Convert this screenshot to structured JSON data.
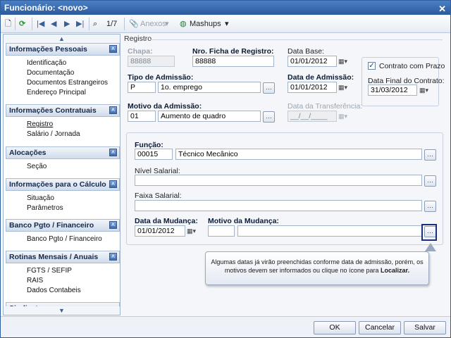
{
  "window": {
    "title": "Funcionário: <novo>"
  },
  "toolbar": {
    "record_counter": "1/7",
    "anexos_label": "Anexos",
    "mashups_label": "Mashups"
  },
  "sidebar": {
    "sections": [
      {
        "title": "Informações Pessoais",
        "items": [
          "Identificação",
          "Documentação",
          "Documentos Estrangeiros",
          "Endereço Principal"
        ]
      },
      {
        "title": "Informações Contratuais",
        "items": [
          "Registro",
          "Salário / Jornada"
        ]
      },
      {
        "title": "Alocações",
        "items": [
          "Seção"
        ]
      },
      {
        "title": "Informações para o Cálculo",
        "items": [
          "Situação",
          "Parâmetros"
        ]
      },
      {
        "title": "Banco Pgto / Financeiro",
        "items": [
          "Banco Pgto / Financeiro"
        ]
      },
      {
        "title": "Rotinas Mensais / Anuais",
        "items": [
          "FGTS / SEFIP",
          "RAIS",
          "Dados Contabeis"
        ]
      },
      {
        "title": "Sindicato",
        "items": []
      }
    ]
  },
  "form": {
    "section_title": "Registro",
    "chapa_label": "Chapa:",
    "chapa_value": "88888",
    "ficha_label": "Nro. Ficha de Registro:",
    "ficha_value": "88888",
    "data_base_label": "Data Base:",
    "data_base_value": "01/01/2012",
    "contrato_prazo_label": "Contrato com Prazo",
    "data_final_label": "Data Final do Contrato:",
    "data_final_value": "31/03/2012",
    "tipo_admissao_label": "Tipo de Admissão:",
    "tipo_admissao_code": "P",
    "tipo_admissao_desc": "1o. emprego",
    "data_admissao_label": "Data de Admissão:",
    "data_admissao_value": "01/01/2012",
    "motivo_admissao_label": "Motivo da Admissão:",
    "motivo_admissao_code": "01",
    "motivo_admissao_desc": "Aumento de quadro",
    "data_transferencia_label": "Data da Transferência:",
    "data_transferencia_value": "__/__/____",
    "funcao_label": "Função:",
    "funcao_code": "00015",
    "funcao_desc": "Técnico Mecânico",
    "nivel_salarial_label": "Nível Salarial:",
    "faixa_salarial_label": "Faixa Salarial:",
    "data_mudanca_label": "Data da Mudança:",
    "data_mudanca_value": "01/01/2012",
    "motivo_mudanca_label": "Motivo da Mudança:",
    "tooltip_text": "Algumas datas já virão preenchidas conforme data de admissão, porém, os motivos devem ser informados ou clique no ícone para",
    "tooltip_bold": "Localizar."
  },
  "footer": {
    "ok_label": "OK",
    "cancel_label": "Cancelar",
    "save_label": "Salvar"
  }
}
